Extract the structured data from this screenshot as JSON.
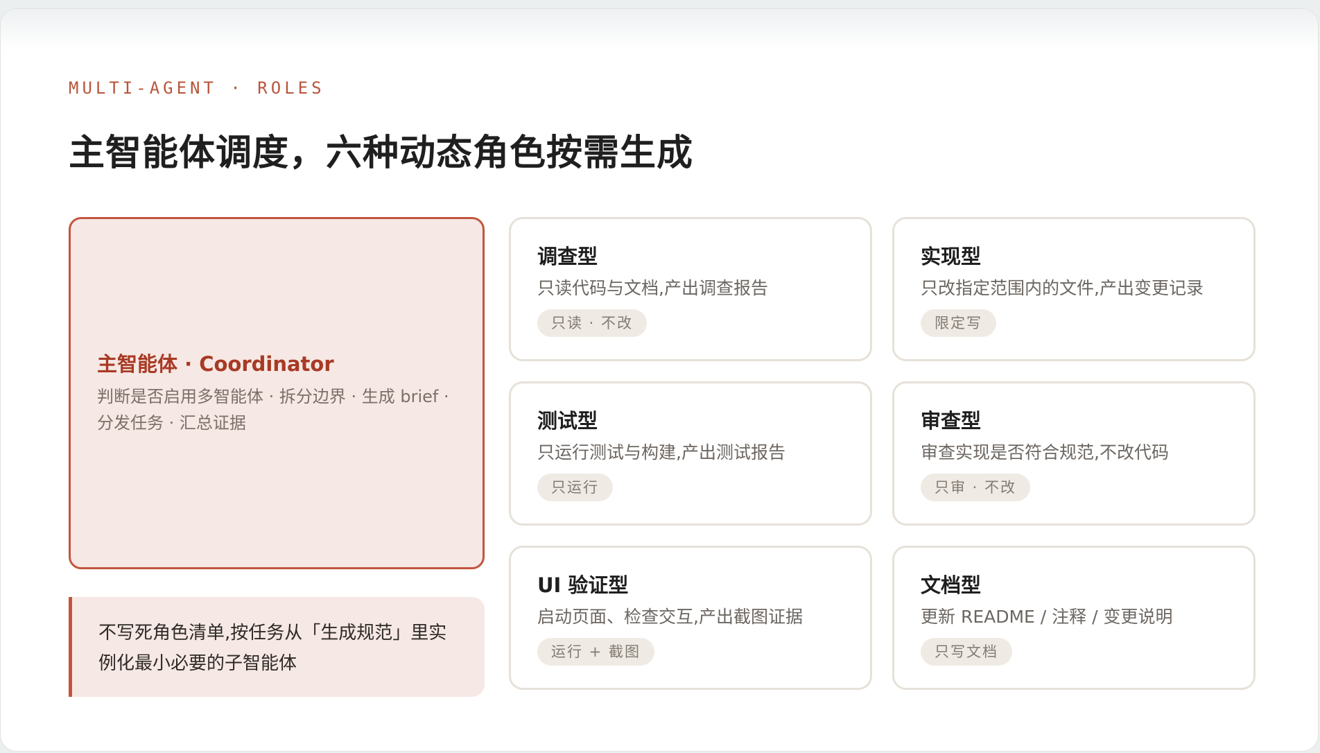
{
  "header": {
    "eyebrow": "MULTI-AGENT · ROLES",
    "title": "主智能体调度，六种动态角色按需生成"
  },
  "coordinator": {
    "title": "主智能体 · Coordinator",
    "description": "判断是否启用多智能体 · 拆分边界 · 生成 brief · 分发任务 · 汇总证据"
  },
  "note": {
    "text": "不写死角色清单,按任务从「生成规范」里实例化最小必要的子智能体"
  },
  "roles": [
    {
      "name": "调查型",
      "description": "只读代码与文档,产出调查报告",
      "tag": "只读 · 不改"
    },
    {
      "name": "实现型",
      "description": "只改指定范围内的文件,产出变更记录",
      "tag": "限定写"
    },
    {
      "name": "测试型",
      "description": "只运行测试与构建,产出测试报告",
      "tag": "只运行"
    },
    {
      "name": "审查型",
      "description": "审查实现是否符合规范,不改代码",
      "tag": "只审 · 不改"
    },
    {
      "name": "UI 验证型",
      "description": "启动页面、检查交互,产出截图证据",
      "tag": "运行 + 截图"
    },
    {
      "name": "文档型",
      "description": "更新 README / 注释 / 变更说明",
      "tag": "只写文档"
    }
  ],
  "colors": {
    "accent": "#c2553e",
    "accent_text": "#a83a24",
    "card_tint": "#f6e8e4",
    "tag_bg": "#efebe4",
    "card_border": "#e6e1d9"
  }
}
